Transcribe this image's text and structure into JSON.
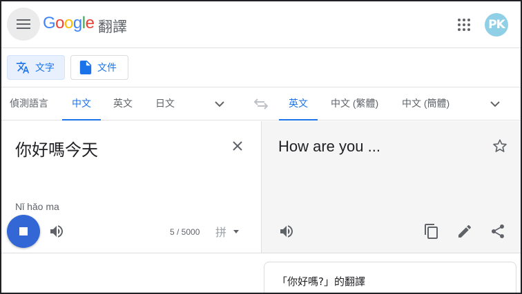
{
  "header": {
    "logo_letters": [
      {
        "ch": "G",
        "color": "#4285F4"
      },
      {
        "ch": "o",
        "color": "#EA4335"
      },
      {
        "ch": "o",
        "color": "#FBBC05"
      },
      {
        "ch": "g",
        "color": "#4285F4"
      },
      {
        "ch": "l",
        "color": "#34A853"
      },
      {
        "ch": "e",
        "color": "#EA4335"
      }
    ],
    "product": "翻譯",
    "avatar_initials": "PK"
  },
  "modes": {
    "text_label": "文字",
    "documents_label": "文件"
  },
  "source_languages": [
    "偵測語言",
    "中文",
    "英文",
    "日文"
  ],
  "source_active": "中文",
  "target_languages": [
    "英文",
    "中文 (繁體)",
    "中文 (簡體)"
  ],
  "target_active": "英文",
  "source": {
    "text": "你好嗎今天",
    "transliteration": "Nǐ hǎo ma",
    "char_count": "5 / 5000",
    "ime_label": "拼"
  },
  "target": {
    "text": "How are you ..."
  },
  "definitions": {
    "title": "「你好嗎?」的翻譯"
  },
  "colors": {
    "accent": "#1a73e8",
    "stop_button": "#3367d6",
    "target_bg": "#f5f5f5",
    "avatar_bg": "#8fd0e6"
  },
  "icons": {
    "menu": "hamburger-icon",
    "apps": "apps-grid-icon",
    "translate": "translate-icon",
    "document": "document-icon",
    "swap": "swap-arrows-icon",
    "clear": "close-icon",
    "star": "star-icon",
    "speaker": "speaker-icon",
    "copy": "copy-icon",
    "edit": "pencil-icon",
    "share": "share-icon",
    "stop": "stop-icon"
  }
}
